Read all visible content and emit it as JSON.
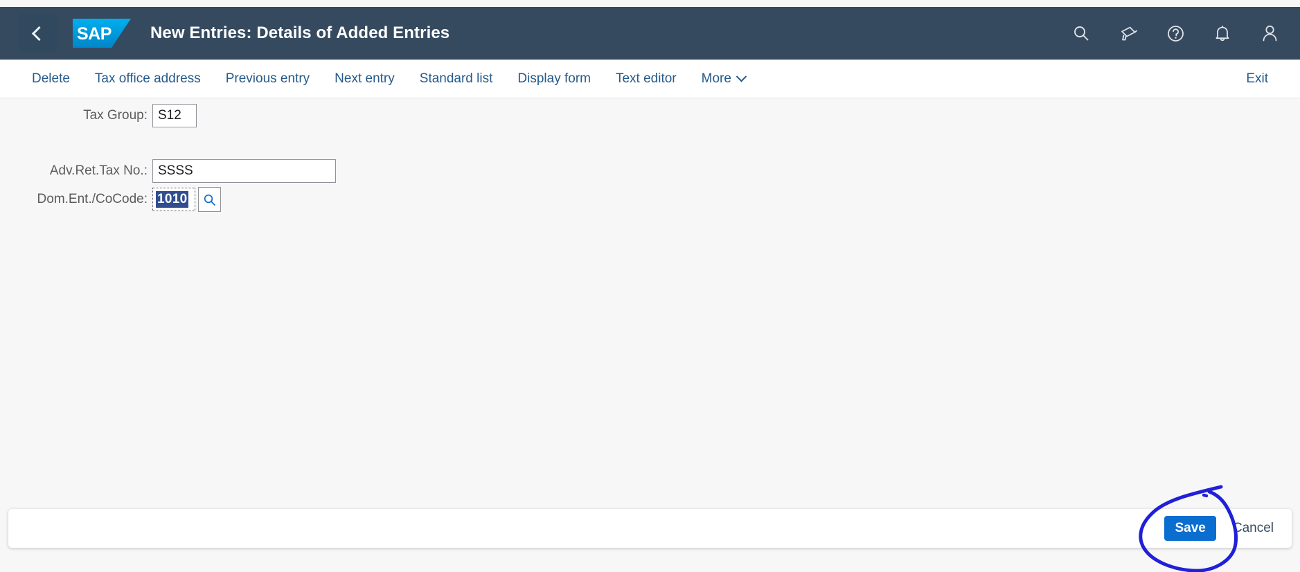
{
  "shell": {
    "back_label": "Back",
    "logo_text": "SAP",
    "title": "New Entries: Details of Added Entries",
    "icons": [
      {
        "name": "search-icon",
        "label": "Search"
      },
      {
        "name": "megaphone-icon",
        "label": "Announcements"
      },
      {
        "name": "help-icon",
        "label": "Help"
      },
      {
        "name": "bell-icon",
        "label": "Notifications"
      },
      {
        "name": "user-icon",
        "label": "User"
      }
    ],
    "colors": {
      "header_bg": "#354a5f",
      "back_bg": "#31495e",
      "logo_blue": "#00aeef",
      "title_color": "#ffffff"
    }
  },
  "toolbar": {
    "items": [
      {
        "label": "Delete"
      },
      {
        "label": "Tax office address"
      },
      {
        "label": "Previous entry"
      },
      {
        "label": "Next entry"
      },
      {
        "label": "Standard list"
      },
      {
        "label": "Display form"
      },
      {
        "label": "Text editor"
      },
      {
        "label": "More",
        "has_chevron": true
      }
    ],
    "exit_label": "Exit",
    "link_color": "#255a8a"
  },
  "form": {
    "fields": [
      {
        "label": "Tax Group:",
        "value": "S12",
        "placeholder": "",
        "type": "text",
        "has_value_help": false
      },
      {
        "label": "Adv.Ret.Tax No.:",
        "value": "SSSS",
        "placeholder": "",
        "type": "text",
        "has_value_help": false
      },
      {
        "label": "Dom.Ent./CoCode:",
        "value": "1010",
        "placeholder": "",
        "type": "text-selected",
        "has_value_help": true,
        "value_help_icon": "search-icon"
      }
    ],
    "selection_color": "#2f4d8f"
  },
  "footer": {
    "save_label": "Save",
    "cancel_label": "Cancel",
    "save_color": "#0a6ed1"
  },
  "annotation": {
    "type": "hand-drawn-circle",
    "target": "save-button",
    "color": "#2020d8"
  }
}
